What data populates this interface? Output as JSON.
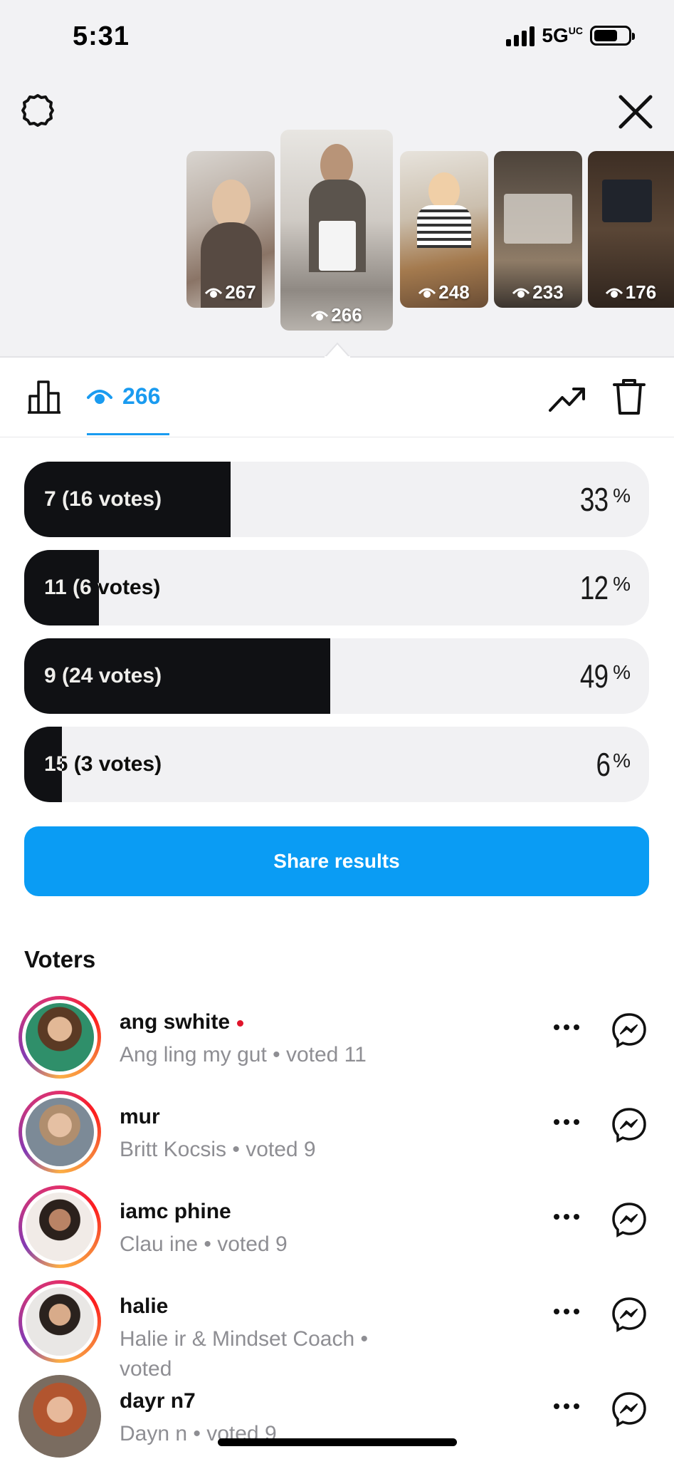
{
  "status_bar": {
    "time": "5:31",
    "network": "5G",
    "network_suffix": "UC"
  },
  "stories": [
    {
      "views": "267"
    },
    {
      "views": "266"
    },
    {
      "views": "248"
    },
    {
      "views": "233"
    },
    {
      "views": "176"
    }
  ],
  "tabs": {
    "viewers_count": "266"
  },
  "poll": {
    "options": [
      {
        "label": "7 (16 votes)",
        "percent": "33",
        "fraction": 0.33
      },
      {
        "label": "11 (6 votes)",
        "percent": "12",
        "fraction": 0.12
      },
      {
        "label": "9 (24 votes)",
        "percent": "49",
        "fraction": 0.49
      },
      {
        "label": "15 (3 votes)",
        "percent": "6",
        "fraction": 0.06
      }
    ],
    "percent_sign": "%"
  },
  "share_button": {
    "label": "Share results"
  },
  "voters": {
    "title": "Voters",
    "items": [
      {
        "username": "ang      swhite",
        "subtitle": "Ang        ling my gut • voted 11",
        "unread": true
      },
      {
        "username": "mur",
        "subtitle": "Britt            Kocsis • voted 9",
        "unread": false
      },
      {
        "username": "iamc        phine",
        "subtitle": "Clau              ine • voted 9",
        "unread": false
      },
      {
        "username": "halie",
        "subtitle": "Halie        ir       & Mindset Coach •",
        "subtitle2": "voted",
        "unread": false
      },
      {
        "username": "dayr      n7",
        "subtitle": "Dayn      n • voted 9",
        "unread": false
      }
    ]
  },
  "colors": {
    "accent": "#0a9cf4",
    "poll_fill": "#101114",
    "poll_track": "#f1f1f3",
    "unread_dot": "#e0142b"
  }
}
